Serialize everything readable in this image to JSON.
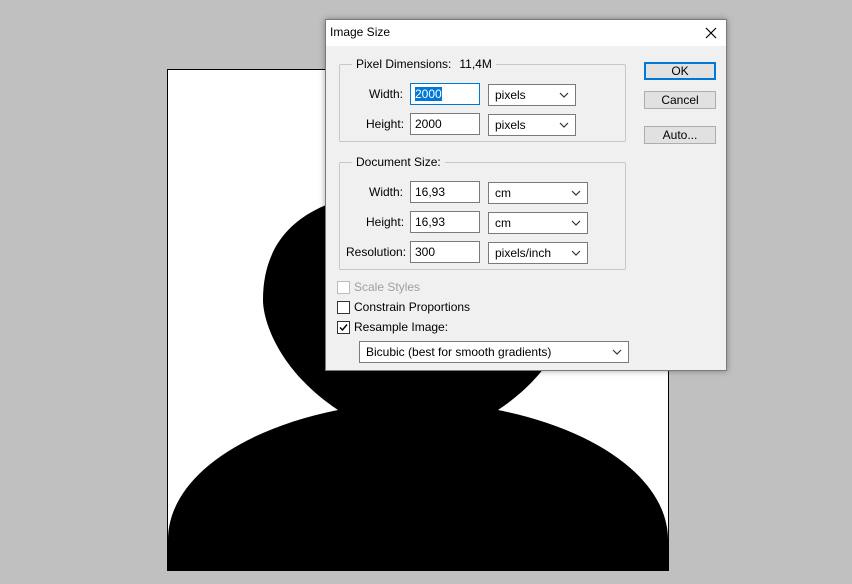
{
  "dialog": {
    "title": "Image Size",
    "pixel_dimensions": {
      "legend": "Pixel Dimensions:",
      "size": "11,4M",
      "width_label": "Width:",
      "width_value": "2000",
      "width_unit": "pixels",
      "height_label": "Height:",
      "height_value": "2000",
      "height_unit": "pixels"
    },
    "document_size": {
      "legend": "Document Size:",
      "width_label": "Width:",
      "width_value": "16,93",
      "width_unit": "cm",
      "height_label": "Height:",
      "height_value": "16,93",
      "height_unit": "cm",
      "resolution_label": "Resolution:",
      "resolution_value": "300",
      "resolution_unit": "pixels/inch"
    },
    "options": {
      "scale_styles": {
        "label": "Scale Styles",
        "checked": false,
        "enabled": false
      },
      "constrain_proportions": {
        "label": "Constrain Proportions",
        "checked": false,
        "enabled": true
      },
      "resample_image": {
        "label": "Resample Image:",
        "checked": true,
        "enabled": true
      },
      "resample_method": "Bicubic (best for smooth gradients)"
    },
    "buttons": {
      "ok": "OK",
      "cancel": "Cancel",
      "auto": "Auto..."
    }
  },
  "icons": {
    "close": "close-icon",
    "dropdown": "chevron-down-icon",
    "check": "checkmark-icon"
  },
  "colors": {
    "focus_blue": "#0078d7",
    "workspace_gray": "#c0c0c0",
    "dialog_bg": "#f0f0f0"
  }
}
